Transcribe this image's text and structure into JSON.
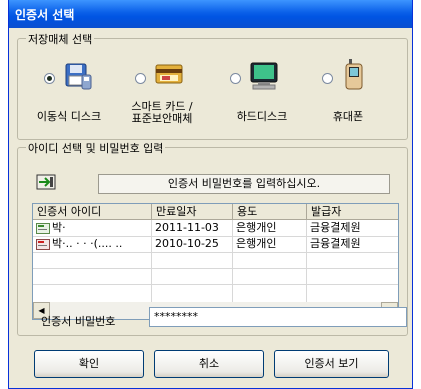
{
  "window": {
    "title": "인증서 선택"
  },
  "storage": {
    "legend": "저장매체 선택",
    "options": [
      {
        "label": "이동식 디스크",
        "selected": true,
        "icon": "removable-disk-icon"
      },
      {
        "label_line1": "스마트 카드 /",
        "label_line2": "표준보안매체",
        "selected": false,
        "icon": "smart-card-icon"
      },
      {
        "label": "하드디스크",
        "selected": false,
        "icon": "hard-disk-monitor-icon"
      },
      {
        "label": "휴대폰",
        "selected": false,
        "icon": "mobile-phone-icon"
      }
    ]
  },
  "idsection": {
    "legend": "아이디 선택 및 비밀번호 입력",
    "instruction": "인증서 비밀번호를 입력하십시오.",
    "columns": [
      "인증서 아이디",
      "만료일자",
      "용도",
      "발급자"
    ],
    "rows": [
      {
        "id": "박·",
        "expiry": "2011-11-03",
        "purpose": "은행개인",
        "issuer": "금융결제원",
        "icon": "certificate-valid-icon"
      },
      {
        "id": "박·.. ·  · ·(.... ..",
        "expiry": "2010-10-25",
        "purpose": "은행개인",
        "issuer": "금융결제원",
        "icon": "certificate-expired-icon"
      }
    ]
  },
  "password": {
    "label": "인증서 비밀번호",
    "value": "********"
  },
  "buttons": {
    "ok": "확인",
    "cancel": "취소",
    "view": "인증서 보기"
  },
  "colors": {
    "titlebar": "#0054e3",
    "window_bg": "#ece9d8",
    "frame": "#0831d9"
  }
}
